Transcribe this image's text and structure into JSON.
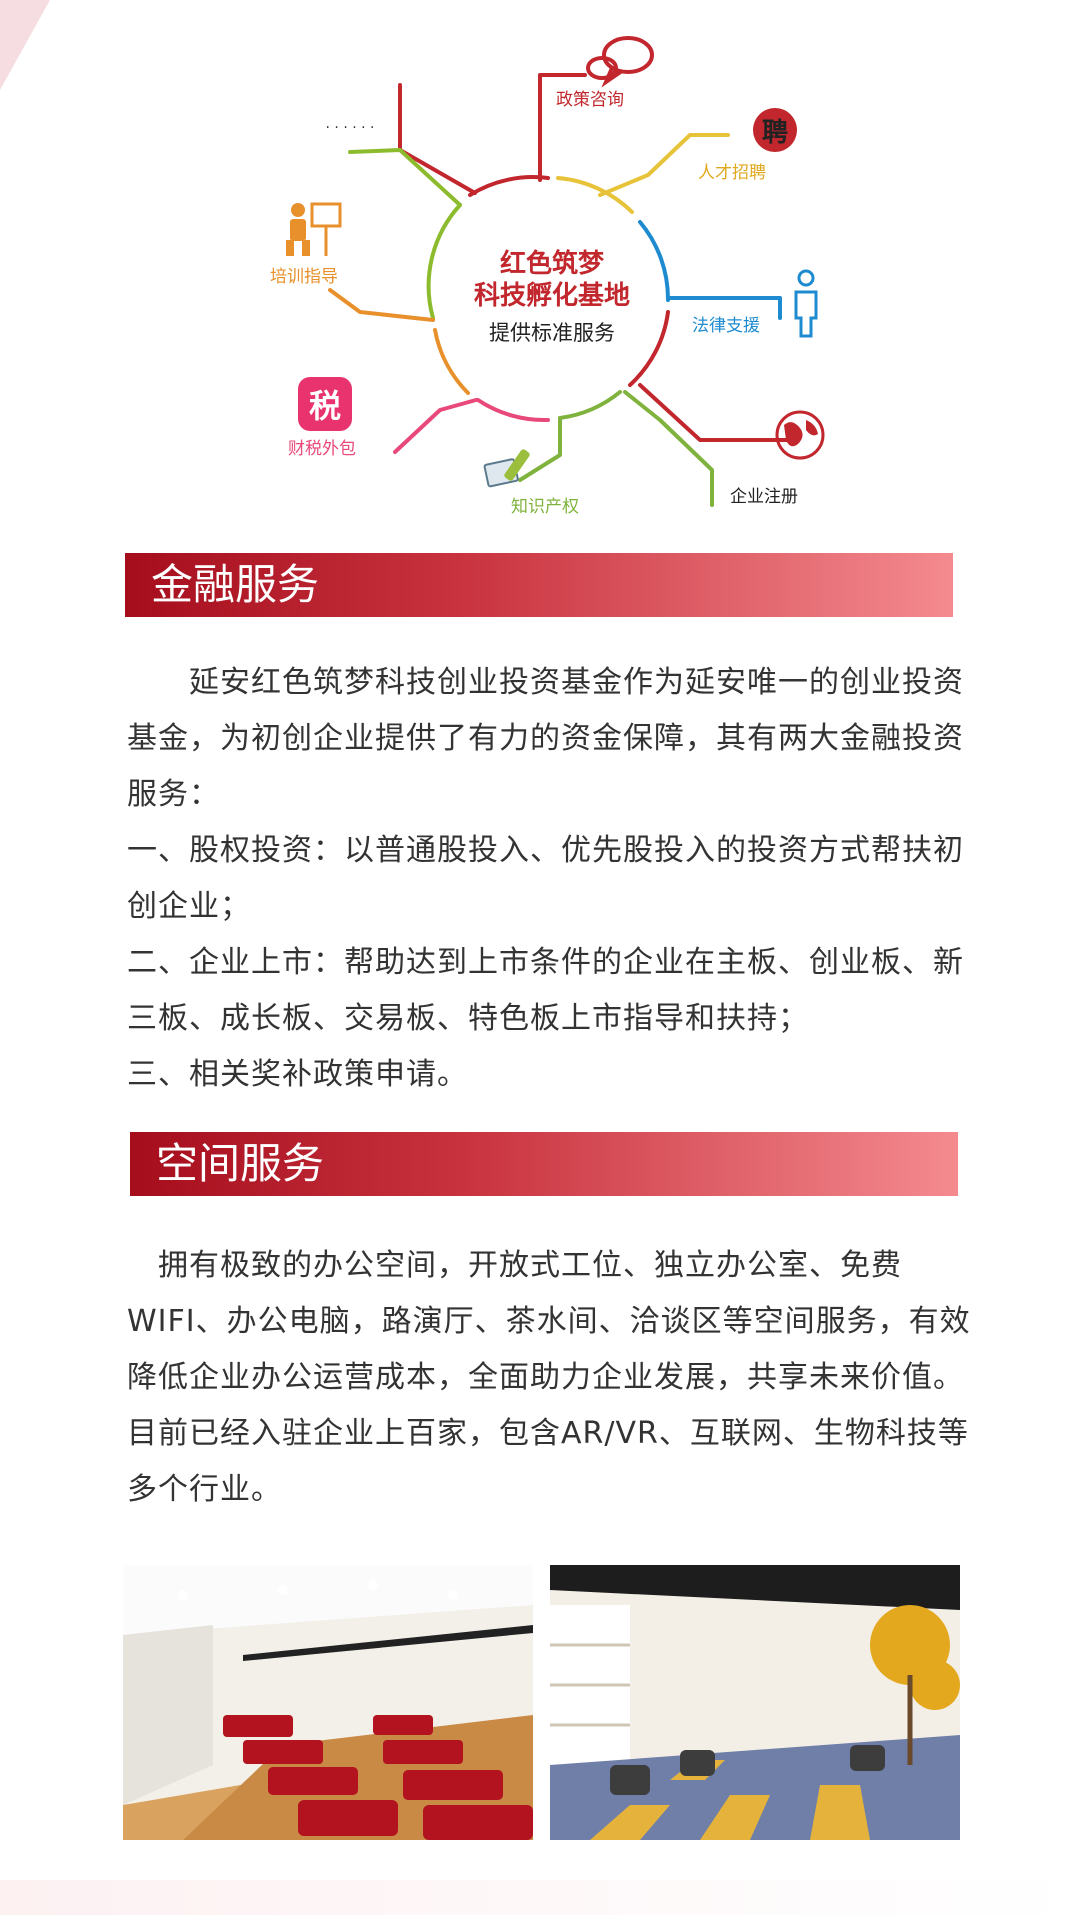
{
  "hub": {
    "line1": "红色筑梦",
    "line2": "科技孵化基地",
    "line3": "提供标准服务"
  },
  "branches": {
    "policy": "政策咨询",
    "talent": "人才招聘",
    "talent_badge": "聘",
    "legal": "法律支援",
    "registration": "企业注册",
    "ip": "知识产权",
    "tax": "财税外包",
    "tax_badge": "税",
    "training": "培训指导",
    "more": "· · · · · ·"
  },
  "finance": {
    "heading": "金融服务",
    "paragraphs": [
      "　　延安红色筑梦科技创业投资基金作为延安唯一的创业投资基金，为初创企业提供了有力的资金保障，其有两大金融投资服务：",
      "一、股权投资：以普通股投入、优先股投入的投资方式帮扶初创企业；",
      "二、企业上市：帮助达到上市条件的企业在主板、创业板、新三板、成长板、交易板、特色板上市指导和扶持；",
      "三、相关奖补政策申请。"
    ]
  },
  "space": {
    "heading": "空间服务",
    "paragraph": "　拥有极致的办公空间，开放式工位、独立办公室、免费WIFI、办公电脑，路演厅、茶水间、洽谈区等空间服务，有效降低企业办公运营成本，全面助力企业发展，共享未来价值。目前已经入驻企业上百家，包含AR/VR、互联网、生物科技等多个行业。"
  },
  "colors": {
    "red": "#c1272d",
    "olive": "#8dbb2e",
    "yellow": "#e7c33a",
    "blue": "#1e8bd0",
    "orange": "#e8912c",
    "pink": "#e8497a",
    "green": "#7fb33d"
  }
}
